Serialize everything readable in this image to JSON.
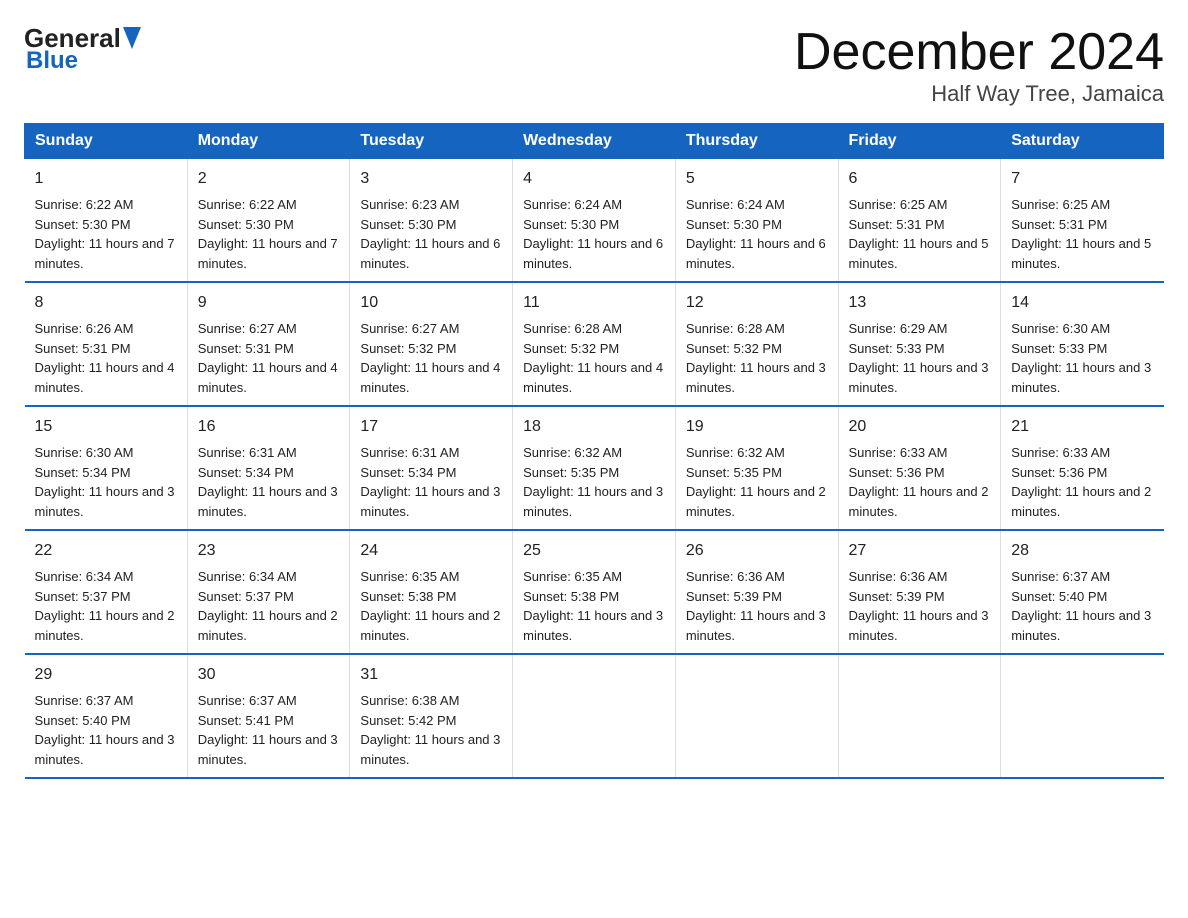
{
  "logo": {
    "general": "General",
    "blue": "Blue"
  },
  "header": {
    "title": "December 2024",
    "subtitle": "Half Way Tree, Jamaica"
  },
  "columns": [
    "Sunday",
    "Monday",
    "Tuesday",
    "Wednesday",
    "Thursday",
    "Friday",
    "Saturday"
  ],
  "weeks": [
    [
      {
        "day": "1",
        "sunrise": "6:22 AM",
        "sunset": "5:30 PM",
        "daylight": "11 hours and 7 minutes."
      },
      {
        "day": "2",
        "sunrise": "6:22 AM",
        "sunset": "5:30 PM",
        "daylight": "11 hours and 7 minutes."
      },
      {
        "day": "3",
        "sunrise": "6:23 AM",
        "sunset": "5:30 PM",
        "daylight": "11 hours and 6 minutes."
      },
      {
        "day": "4",
        "sunrise": "6:24 AM",
        "sunset": "5:30 PM",
        "daylight": "11 hours and 6 minutes."
      },
      {
        "day": "5",
        "sunrise": "6:24 AM",
        "sunset": "5:30 PM",
        "daylight": "11 hours and 6 minutes."
      },
      {
        "day": "6",
        "sunrise": "6:25 AM",
        "sunset": "5:31 PM",
        "daylight": "11 hours and 5 minutes."
      },
      {
        "day": "7",
        "sunrise": "6:25 AM",
        "sunset": "5:31 PM",
        "daylight": "11 hours and 5 minutes."
      }
    ],
    [
      {
        "day": "8",
        "sunrise": "6:26 AM",
        "sunset": "5:31 PM",
        "daylight": "11 hours and 4 minutes."
      },
      {
        "day": "9",
        "sunrise": "6:27 AM",
        "sunset": "5:31 PM",
        "daylight": "11 hours and 4 minutes."
      },
      {
        "day": "10",
        "sunrise": "6:27 AM",
        "sunset": "5:32 PM",
        "daylight": "11 hours and 4 minutes."
      },
      {
        "day": "11",
        "sunrise": "6:28 AM",
        "sunset": "5:32 PM",
        "daylight": "11 hours and 4 minutes."
      },
      {
        "day": "12",
        "sunrise": "6:28 AM",
        "sunset": "5:32 PM",
        "daylight": "11 hours and 3 minutes."
      },
      {
        "day": "13",
        "sunrise": "6:29 AM",
        "sunset": "5:33 PM",
        "daylight": "11 hours and 3 minutes."
      },
      {
        "day": "14",
        "sunrise": "6:30 AM",
        "sunset": "5:33 PM",
        "daylight": "11 hours and 3 minutes."
      }
    ],
    [
      {
        "day": "15",
        "sunrise": "6:30 AM",
        "sunset": "5:34 PM",
        "daylight": "11 hours and 3 minutes."
      },
      {
        "day": "16",
        "sunrise": "6:31 AM",
        "sunset": "5:34 PM",
        "daylight": "11 hours and 3 minutes."
      },
      {
        "day": "17",
        "sunrise": "6:31 AM",
        "sunset": "5:34 PM",
        "daylight": "11 hours and 3 minutes."
      },
      {
        "day": "18",
        "sunrise": "6:32 AM",
        "sunset": "5:35 PM",
        "daylight": "11 hours and 3 minutes."
      },
      {
        "day": "19",
        "sunrise": "6:32 AM",
        "sunset": "5:35 PM",
        "daylight": "11 hours and 2 minutes."
      },
      {
        "day": "20",
        "sunrise": "6:33 AM",
        "sunset": "5:36 PM",
        "daylight": "11 hours and 2 minutes."
      },
      {
        "day": "21",
        "sunrise": "6:33 AM",
        "sunset": "5:36 PM",
        "daylight": "11 hours and 2 minutes."
      }
    ],
    [
      {
        "day": "22",
        "sunrise": "6:34 AM",
        "sunset": "5:37 PM",
        "daylight": "11 hours and 2 minutes."
      },
      {
        "day": "23",
        "sunrise": "6:34 AM",
        "sunset": "5:37 PM",
        "daylight": "11 hours and 2 minutes."
      },
      {
        "day": "24",
        "sunrise": "6:35 AM",
        "sunset": "5:38 PM",
        "daylight": "11 hours and 2 minutes."
      },
      {
        "day": "25",
        "sunrise": "6:35 AM",
        "sunset": "5:38 PM",
        "daylight": "11 hours and 3 minutes."
      },
      {
        "day": "26",
        "sunrise": "6:36 AM",
        "sunset": "5:39 PM",
        "daylight": "11 hours and 3 minutes."
      },
      {
        "day": "27",
        "sunrise": "6:36 AM",
        "sunset": "5:39 PM",
        "daylight": "11 hours and 3 minutes."
      },
      {
        "day": "28",
        "sunrise": "6:37 AM",
        "sunset": "5:40 PM",
        "daylight": "11 hours and 3 minutes."
      }
    ],
    [
      {
        "day": "29",
        "sunrise": "6:37 AM",
        "sunset": "5:40 PM",
        "daylight": "11 hours and 3 minutes."
      },
      {
        "day": "30",
        "sunrise": "6:37 AM",
        "sunset": "5:41 PM",
        "daylight": "11 hours and 3 minutes."
      },
      {
        "day": "31",
        "sunrise": "6:38 AM",
        "sunset": "5:42 PM",
        "daylight": "11 hours and 3 minutes."
      },
      null,
      null,
      null,
      null
    ]
  ]
}
